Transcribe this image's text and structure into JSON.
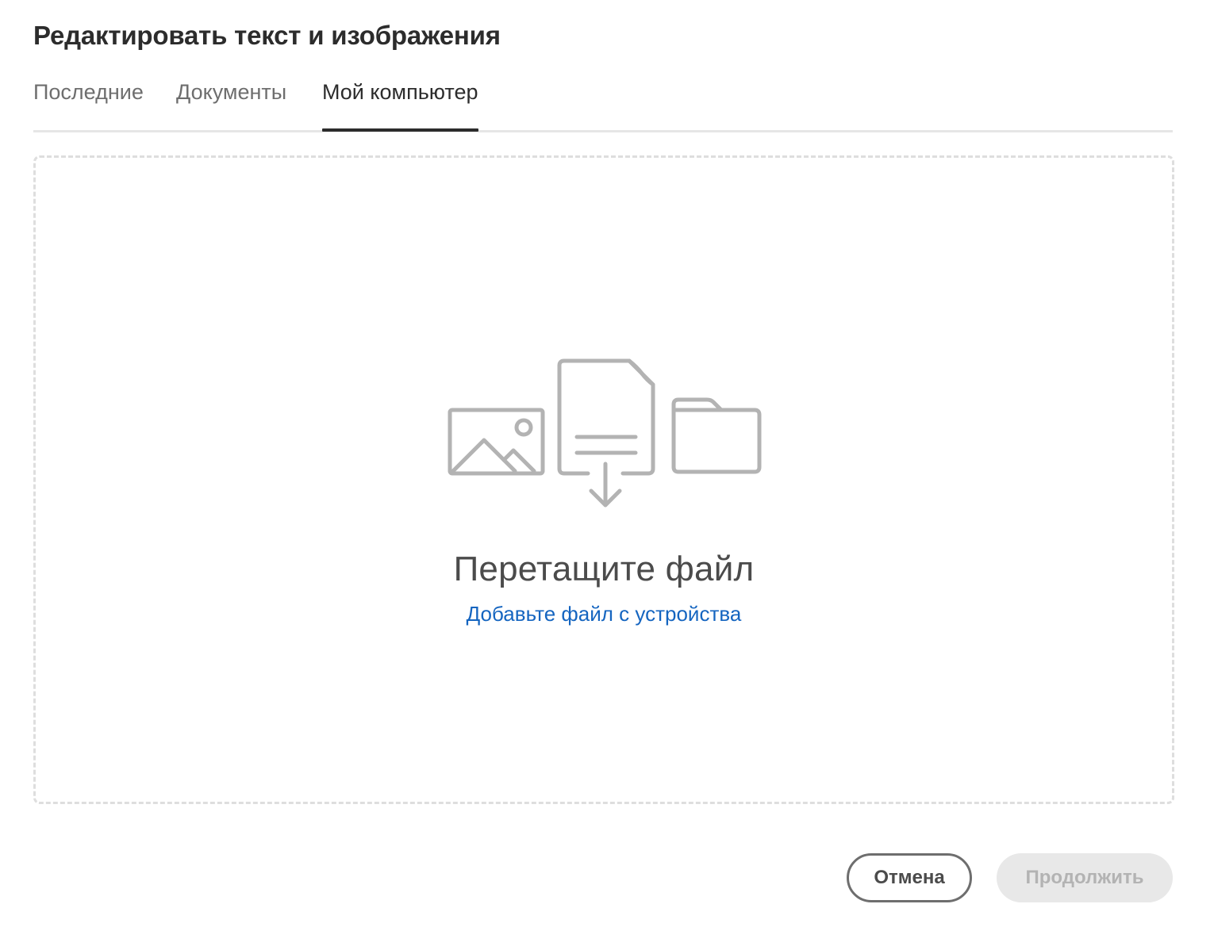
{
  "dialog": {
    "title": "Редактировать текст и изображения"
  },
  "tabs": [
    {
      "label": "Последние",
      "active": false
    },
    {
      "label": "Документы",
      "active": false
    },
    {
      "label": "Мой компьютер",
      "active": true
    }
  ],
  "dropzone": {
    "title": "Перетащите файл",
    "link_label": "Добавьте файл с устройства",
    "icons": [
      "image-icon",
      "file-download-icon",
      "folder-icon"
    ]
  },
  "footer": {
    "cancel_label": "Отмена",
    "continue_label": "Продолжить",
    "continue_disabled": true
  },
  "colors": {
    "link": "#1565c0",
    "text_primary": "#2c2c2c",
    "text_secondary": "#6e6e6e",
    "illustration": "#b3b3b3",
    "disabled_bg": "#e8e8e8"
  }
}
